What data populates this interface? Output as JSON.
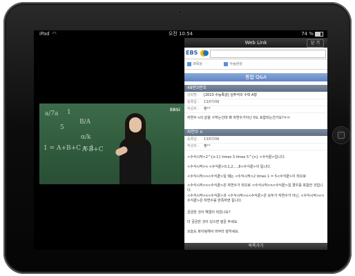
{
  "status_bar": {
    "device": "iPad",
    "time": "오전 10:54",
    "battery": "74 %",
    "wifi_icon": "wifi-icon"
  },
  "video": {
    "logo": "EBSi",
    "chalk_lines": [
      "1",
      "a/7a",
      "B/A",
      "5",
      "α/k",
      "1 = A+B+C = 1",
      "A-B+C"
    ]
  },
  "panel": {
    "title": "Web Link",
    "close_label": "닫 기",
    "brand": "EBS",
    "tabs": [
      "과목상",
      "수능완성"
    ],
    "qa_title": "통합 Q&A",
    "question": {
      "header": "48번3번조",
      "fields": [
        {
          "label": "강좌명 :",
          "value": "[2013 수능특강] 심주석의 수학 A형"
        },
        {
          "label": "등록일 :",
          "value": "13/07/06"
        },
        {
          "label": "작성자 :",
          "value": "빵**"
        }
      ],
      "body": "자연수 n의 값을 구하는건데 왜 자연수가아닌 0도 포함되는건가요?ㅠㅠ"
    },
    "answer": {
      "header": "자연수 n",
      "fields": [
        {
          "label": "등록일 :",
          "value": "13/07/06"
        },
        {
          "label": "작성자 :",
          "value": "빵**"
        }
      ],
      "paragraphs": [
        "<수식시작>2^{n-1} times 3 times 5^{n} <수식끝>입니다.",
        "<수식시작>n <수식끝>0,1,2,...,8<수식끝>이 됩니다.",
        "<수식시작>n<수식끝>일 때는 <수식시작>2 times 1 = 5<수식끝>이 되므로",
        "<수식시작>n<수식끝>은 자연수가 되므로 <수식시작>n<수식끝>일 경우를 포함한 것입니다.",
        "<수식시작>n<수식끝>과 <수식시작>n<수식끝>은 모두가 자연수가 아닌, <수식시작>n<수식끝>은 자연수를 만족하면 됩니다.",
        "궁금한 것이 해결이 되었나요?",
        "더 궁금한 것이 있으면 질문 주세요.",
        "오늘도 화이팅해서 마무리 잘하세요."
      ]
    },
    "back_label": "목록가기"
  }
}
